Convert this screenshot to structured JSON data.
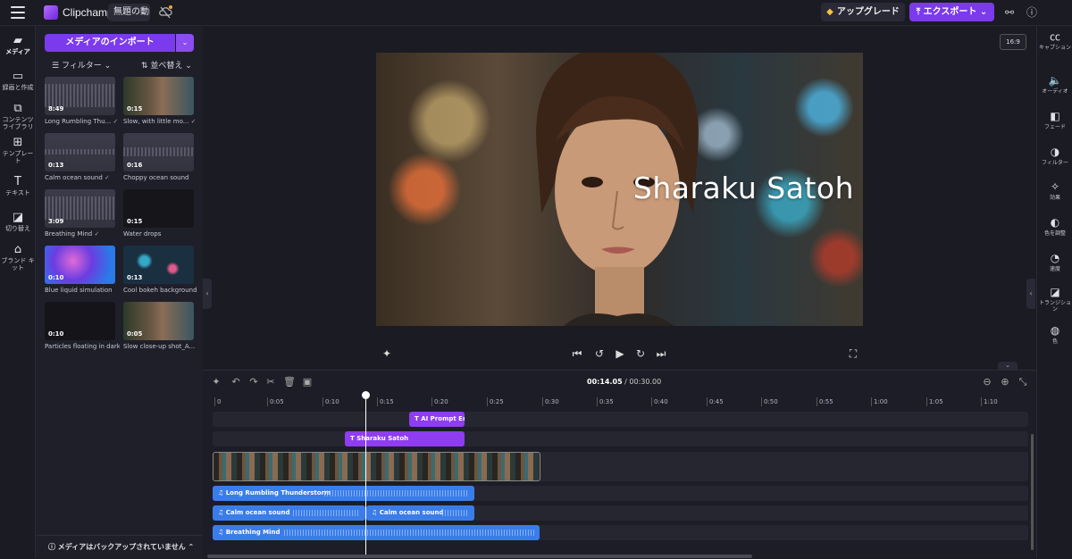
{
  "header": {
    "app_name": "Clipchamp",
    "project_title": "無題の動画",
    "upgrade_label": "アップグレード",
    "export_label": "エクスポート"
  },
  "left_rail": [
    {
      "icon": "folder-icon",
      "label": "メディア"
    },
    {
      "icon": "record-icon",
      "label": "録画と作成"
    },
    {
      "icon": "library-icon",
      "label": "コンテンツ ライブラリ"
    },
    {
      "icon": "template-icon",
      "label": "テンプレート"
    },
    {
      "icon": "text-icon",
      "label": "テキスト"
    },
    {
      "icon": "transition-icon",
      "label": "切り替え"
    },
    {
      "icon": "brand-icon",
      "label": "ブランド キット"
    }
  ],
  "media_panel": {
    "import_label": "メディアのインポート",
    "filter_label": "フィルター",
    "sort_label": "並べ替え",
    "backup_notice": "メディアはバックアップされていません",
    "items": [
      {
        "kind": "audio",
        "duration": "8:49",
        "label": "Long Rumbling Thu..."
      },
      {
        "kind": "video",
        "duration": "0:15",
        "label": "Slow, with little mo..."
      },
      {
        "kind": "audio",
        "duration": "0:13",
        "label": "Calm ocean sound"
      },
      {
        "kind": "audio",
        "duration": "0:16",
        "label": "Choppy ocean sound"
      },
      {
        "kind": "audio",
        "duration": "3:09",
        "label": "Breathing Mind"
      },
      {
        "kind": "dark",
        "duration": "0:15",
        "label": "Water drops"
      },
      {
        "kind": "liquid",
        "duration": "0:10",
        "label": "Blue liquid simulation"
      },
      {
        "kind": "bokeh",
        "duration": "0:13",
        "label": "Cool bokeh background"
      },
      {
        "kind": "dark",
        "duration": "0:10",
        "label": "Particles floating in dark"
      },
      {
        "kind": "video",
        "duration": "0:05",
        "label": "Slow close-up shot_A..."
      }
    ]
  },
  "stage": {
    "aspect_ratio": "16:9",
    "caption_text": "Sharaku Satoh"
  },
  "right_rail": [
    {
      "icon": "cc-icon",
      "label": "キャプション"
    },
    {
      "icon": "audio-icon",
      "label": "オーディオ"
    },
    {
      "icon": "fade-icon",
      "label": "フェード"
    },
    {
      "icon": "filter-icon",
      "label": "フィルター"
    },
    {
      "icon": "effects-icon",
      "label": "効果"
    },
    {
      "icon": "color-adjust-icon",
      "label": "色を調整"
    },
    {
      "icon": "speed-icon",
      "label": "速度"
    },
    {
      "icon": "transition-icon",
      "label": "トランジション"
    },
    {
      "icon": "color-icon",
      "label": "色"
    }
  ],
  "timeline": {
    "current_time": "00:14.05",
    "total_time": "00:30.00",
    "ruler_ticks": [
      "0",
      "0:05",
      "0:10",
      "0:15",
      "0:20",
      "0:25",
      "0:30",
      "0:35",
      "0:40",
      "0:45",
      "0:50",
      "0:55",
      "1:00",
      "1:05",
      "1:10"
    ],
    "clips": {
      "text1": "AI Prompt En",
      "text2": "Sharaku Satoh",
      "audio1": "Long Rumbling Thunderstorm",
      "audio2a": "Calm ocean sound",
      "audio2b": "Calm ocean sound",
      "audio3": "Breathing Mind"
    }
  },
  "colors": {
    "accent": "#7c3aed",
    "text_clip": "#8e3df0",
    "audio_clip": "#3b7de8"
  }
}
